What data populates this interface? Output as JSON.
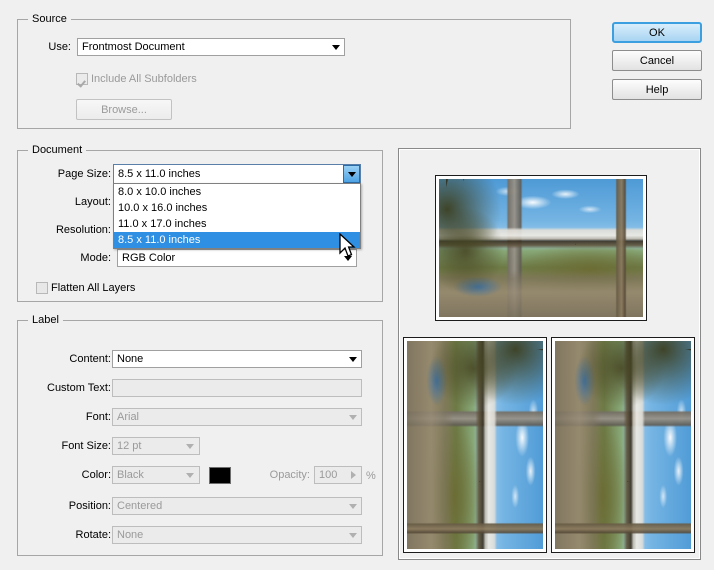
{
  "dialog": {
    "background_color": "#f0f0f0",
    "accent_color": "#2f8fe3"
  },
  "buttons": {
    "ok": "OK",
    "cancel": "Cancel",
    "help": "Help"
  },
  "source": {
    "title": "Source",
    "use_label": "Use:",
    "use_value": "Frontmost Document",
    "include_subfolders_label": "Include All Subfolders",
    "include_subfolders_checked": true,
    "include_subfolders_disabled": true,
    "browse_label": "Browse...",
    "browse_disabled": true
  },
  "document": {
    "title": "Document",
    "page_size_label": "Page Size:",
    "page_size_value": "8.5 x 11.0 inches",
    "page_size_options": [
      "8.0 x 10.0 inches",
      "10.0 x 16.0 inches",
      "11.0 x 17.0 inches",
      "8.5 x 11.0 inches"
    ],
    "page_size_selected_index": 3,
    "layout_label": "Layout:",
    "resolution_label": "Resolution:",
    "mode_label": "Mode:",
    "mode_value": "RGB Color",
    "flatten_label": "Flatten All Layers",
    "flatten_checked": false
  },
  "label": {
    "title": "Label",
    "content_label": "Content:",
    "content_value": "None",
    "custom_text_label": "Custom Text:",
    "custom_text_value": "",
    "custom_text_placeholder": "",
    "font_label": "Font:",
    "font_value": "Arial",
    "font_size_label": "Font Size:",
    "font_size_value": "12 pt",
    "color_label": "Color:",
    "color_value": "Black",
    "color_swatch": "#000000",
    "opacity_label": "Opacity:",
    "opacity_value": "100",
    "opacity_unit": "%",
    "position_label": "Position:",
    "position_value": "Centered",
    "rotate_label": "Rotate:",
    "rotate_value": "None"
  },
  "preview": {
    "name": "layout-preview",
    "main_thumb_alt": "covered bridge over creek",
    "thumb_left_alt": "covered bridge rotated 90 degrees",
    "thumb_right_alt": "covered bridge rotated 90 degrees"
  },
  "icons": {
    "dropdown_arrow": "chevron-down-icon",
    "stepper_right": "chevron-right-icon",
    "mouse_pointer": "mouse-cursor-icon"
  }
}
